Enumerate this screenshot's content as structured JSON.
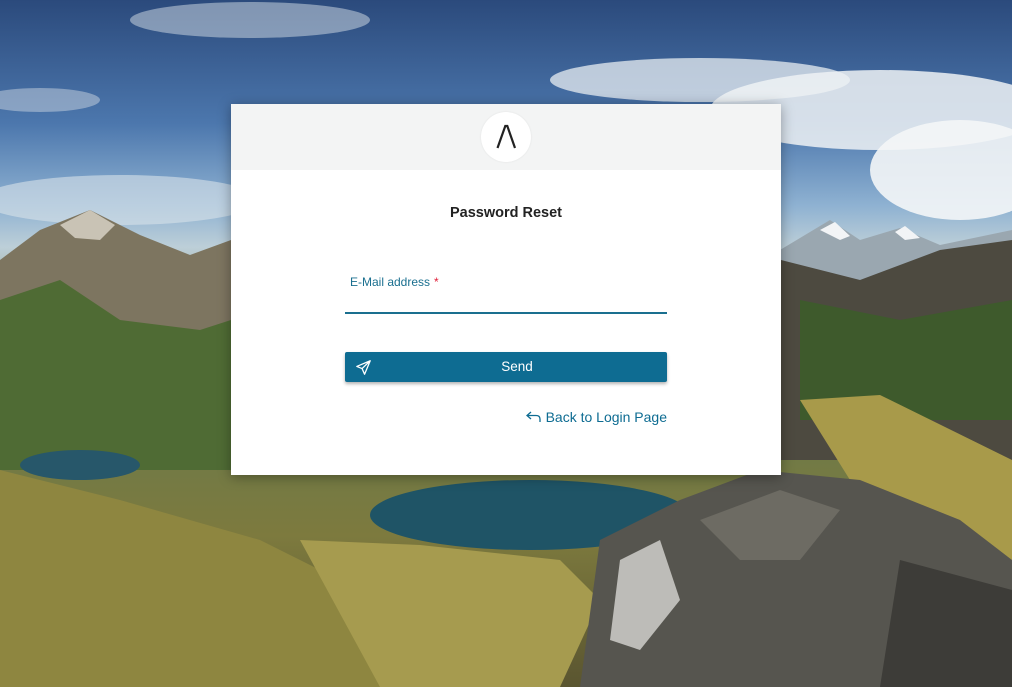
{
  "logo": {
    "glyph": "Λ"
  },
  "form": {
    "title": "Password Reset",
    "email": {
      "label": "E-Mail address",
      "required_mark": "*",
      "value": "",
      "placeholder": ""
    },
    "send_button": {
      "label": "Send",
      "icon": "paper-plane-icon"
    },
    "back_link": {
      "label": "Back to Login Page",
      "icon": "return-arrow-icon"
    }
  },
  "colors": {
    "accent": "#0e6c92",
    "label": "#1a6f8f",
    "required": "#e0203a",
    "header_bg": "#f3f4f4"
  }
}
